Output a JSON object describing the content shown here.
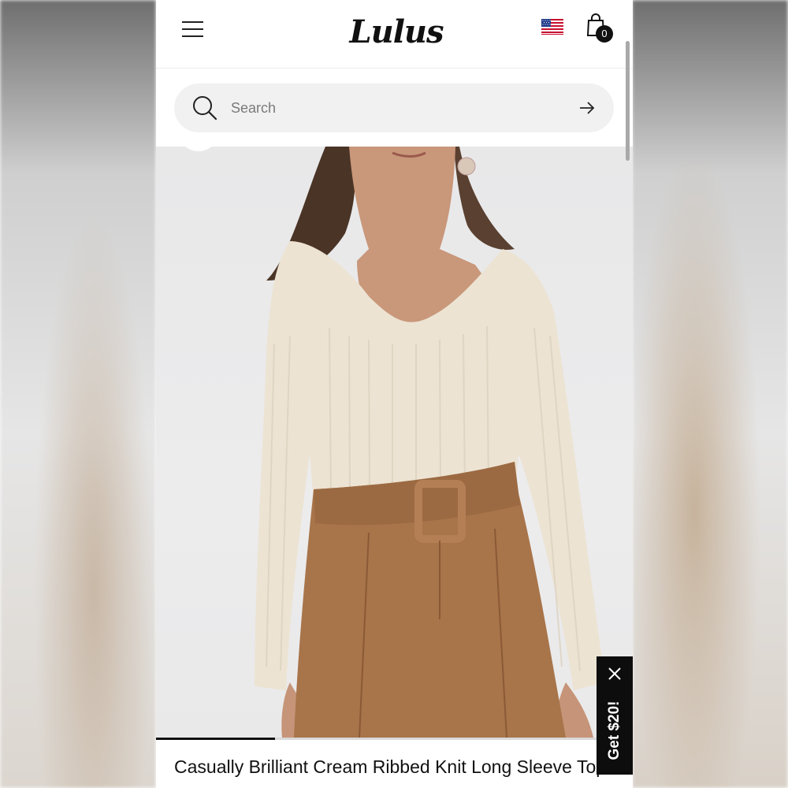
{
  "header": {
    "logo_text": "Lulus",
    "cart_count": "0",
    "flag": "us-flag-icon"
  },
  "search": {
    "placeholder": "Search"
  },
  "product": {
    "title": "Casually Brilliant Cream Ribbed Knit Long Sleeve Top",
    "gallery_progress": 0.25
  },
  "promo": {
    "label": "Get $20!"
  },
  "colors": {
    "accent": "#111111",
    "search_bg": "#f1f1f1",
    "promo_bg": "#0d0d0d"
  }
}
